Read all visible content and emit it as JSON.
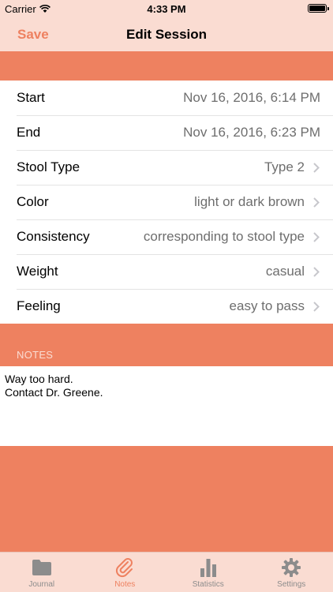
{
  "status_bar": {
    "carrier": "Carrier",
    "time": "4:33 PM"
  },
  "nav": {
    "save_label": "Save",
    "title": "Edit Session"
  },
  "rows": [
    {
      "label": "Start",
      "value": "Nov 16, 2016, 6:14 PM"
    },
    {
      "label": "End",
      "value": "Nov 16, 2016, 6:23 PM"
    },
    {
      "label": "Stool Type",
      "value": "Type 2"
    },
    {
      "label": "Color",
      "value": "light or dark brown"
    },
    {
      "label": "Consistency",
      "value": "corresponding to stool type"
    },
    {
      "label": "Weight",
      "value": "casual"
    },
    {
      "label": "Feeling",
      "value": "easy to pass"
    }
  ],
  "notes": {
    "header": "NOTES",
    "lines": [
      "Way too hard.",
      "Contact Dr. Greene."
    ]
  },
  "tabs": [
    {
      "label": "Journal",
      "icon": "folder-icon"
    },
    {
      "label": "Notes",
      "icon": "paperclip-icon"
    },
    {
      "label": "Statistics",
      "icon": "bar-chart-icon"
    },
    {
      "label": "Settings",
      "icon": "gear-icon"
    }
  ],
  "colors": {
    "accent": "#EE8160",
    "bar_bg": "#FADCD2",
    "tab_inactive": "#8C8C8C"
  }
}
